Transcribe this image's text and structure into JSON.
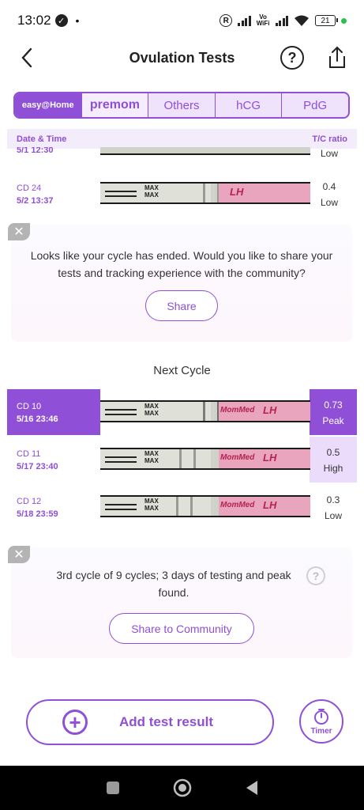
{
  "status": {
    "time": "13:02",
    "battery": "21",
    "volte": "Vo\nWiFi"
  },
  "header": {
    "title": "Ovulation Tests",
    "help": "?"
  },
  "tabs": [
    {
      "label": "easy@Home",
      "active": true
    },
    {
      "label": "premom",
      "active": false
    },
    {
      "label": "Others",
      "active": false
    },
    {
      "label": "hCG",
      "active": false
    },
    {
      "label": "PdG",
      "active": false
    }
  ],
  "table": {
    "col_date": "Date & Time",
    "col_ratio": "T/C ratio"
  },
  "rows": [
    {
      "cd": "",
      "date": "5/1  12:30",
      "ratio": "",
      "level": "Low"
    },
    {
      "cd": "CD 24",
      "date": "5/2  13:37",
      "ratio": "0.4",
      "level": "Low"
    },
    {
      "cd": "CD 10",
      "date": "5/16  23:46",
      "ratio": "0.73",
      "level": "Peak"
    },
    {
      "cd": "CD 11",
      "date": "5/17  23:40",
      "ratio": "0.5",
      "level": "High"
    },
    {
      "cd": "CD 12",
      "date": "5/18  23:59",
      "ratio": "0.3",
      "level": "Low"
    }
  ],
  "strip": {
    "max": "MAX",
    "lh": "LH",
    "brand": "MomMed"
  },
  "card1": {
    "text": "Looks like your cycle has ended. Would you like to share your tests and tracking experience with the community?",
    "button": "Share"
  },
  "next_cycle": "Next Cycle",
  "card2": {
    "text": "3rd cycle of 9 cycles; 3 days of testing and peak found.",
    "button": "Share to Community"
  },
  "actions": {
    "add": "Add test result",
    "timer": "Timer"
  },
  "colors": {
    "accent": "#8f4fd6",
    "accent_light": "#ecdcfb"
  }
}
